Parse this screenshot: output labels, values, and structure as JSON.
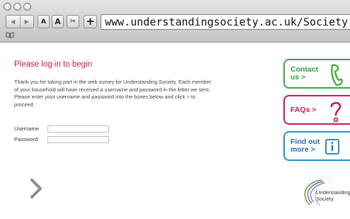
{
  "browser": {
    "url": "www.understandingsociety.ac.uk/Society",
    "font_small_label": "A",
    "font_large_label": "A",
    "add_label": "+",
    "back_glyph": "◀",
    "forward_glyph": "▶",
    "tools_glyph": "✂",
    "bookmarks_glyph": "📖"
  },
  "page": {
    "heading": "Please log in to begin",
    "intro": "Thank you for taking part in the web survey for Understanding Society. Each member of your household will have received a username and password in the letter we sent. Please enter your username and password into the boxes below and click > to proceed.",
    "username_label": "Username",
    "password_label": "Password",
    "username_value": "",
    "password_value": ""
  },
  "sidebar": {
    "contact_line1": "Contact",
    "contact_line2": "us >",
    "faq_label": "FAQs >",
    "findout_line1": "Find out",
    "findout_line2": "more >"
  },
  "logo": {
    "line1": "Understanding",
    "line2": "Society"
  },
  "colors": {
    "heading": "#d4145a",
    "contact": "#39a935",
    "faq": "#d4145a",
    "findout": "#2a8ec9"
  },
  "icons": {
    "proceed": "chevron-right-icon",
    "contact": "phone-icon",
    "faq": "question-mark-icon",
    "findout": "info-icon"
  }
}
